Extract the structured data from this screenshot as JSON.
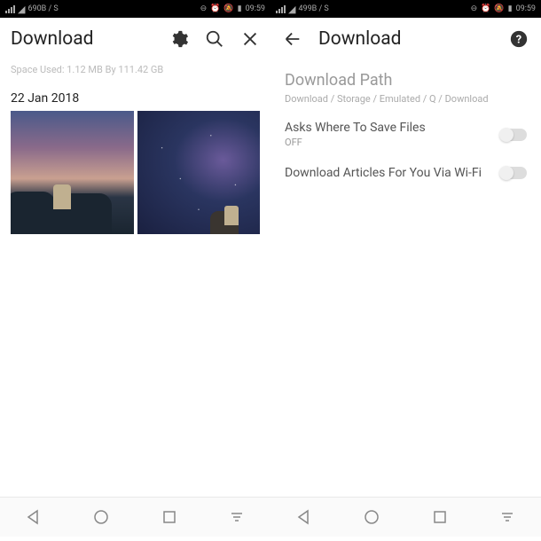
{
  "left": {
    "status": {
      "speed": "690B / S",
      "time": "09:59"
    },
    "header": {
      "title": "Download"
    },
    "space_used": "Space Used: 1.12 MB By 111.42 GB",
    "date": "22 Jan 2018"
  },
  "right": {
    "status": {
      "speed": "499B / S",
      "time": "09:59"
    },
    "header": {
      "title": "Download"
    },
    "section": {
      "title": "Download Path",
      "path": "Download / Storage / Emulated / Q / Download"
    },
    "settings": [
      {
        "label": "Asks Where To Save Files",
        "sub": "OFF"
      },
      {
        "label": "Download Articles For You Via Wi-Fi",
        "sub": ""
      }
    ]
  },
  "nav": {
    "back": "◁",
    "home": "○",
    "recent": "□",
    "menu": "≡"
  }
}
